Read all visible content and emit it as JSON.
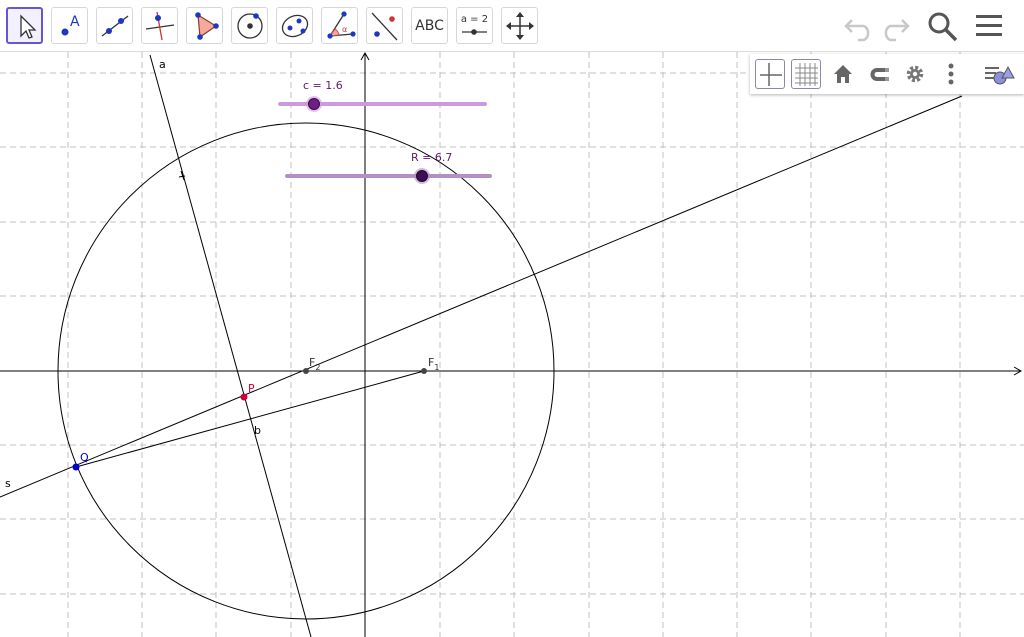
{
  "toolbar": {
    "tools": [
      {
        "name": "move"
      },
      {
        "name": "point",
        "label": "A"
      },
      {
        "name": "line"
      },
      {
        "name": "perpendicular-line"
      },
      {
        "name": "polygon"
      },
      {
        "name": "circle-center-point"
      },
      {
        "name": "ellipse"
      },
      {
        "name": "angle",
        "label": "α"
      },
      {
        "name": "reflect-about-line"
      },
      {
        "name": "text",
        "label": "ABC"
      },
      {
        "name": "slider",
        "label": "a = 2"
      },
      {
        "name": "move-graphics-view"
      }
    ],
    "selected_tool": "move"
  },
  "header": {
    "undo_icon": "undo-icon",
    "redo_icon": "redo-icon",
    "search_icon": "search-icon",
    "menu_icon": "hamburger-menu-icon"
  },
  "style_bar": {
    "buttons": [
      {
        "name": "axes",
        "active": true
      },
      {
        "name": "grid",
        "active": true
      },
      {
        "name": "standard-view"
      },
      {
        "name": "point-capturing"
      },
      {
        "name": "graphics-settings"
      },
      {
        "name": "more"
      },
      {
        "name": "toggle-style-bar"
      }
    ]
  },
  "colors": {
    "slider_track": "#cc99dd",
    "slider_point": "#5c1a6e",
    "point_red": "#cc0033",
    "point_blue": "#0000cc",
    "grid": "#c0c0c0",
    "axis": "#000000",
    "accent": "#6557d2"
  },
  "construction": {
    "sliders": [
      {
        "label": "c = 1.6"
      },
      {
        "label": "R = 6.7"
      }
    ],
    "points": [
      {
        "label": "F",
        "subscript": "1"
      },
      {
        "label": "F",
        "subscript": "2"
      },
      {
        "label": "P"
      },
      {
        "label": "Q"
      }
    ],
    "lines": [
      {
        "label": "a"
      },
      {
        "label": "b"
      },
      {
        "label": "s"
      }
    ]
  }
}
